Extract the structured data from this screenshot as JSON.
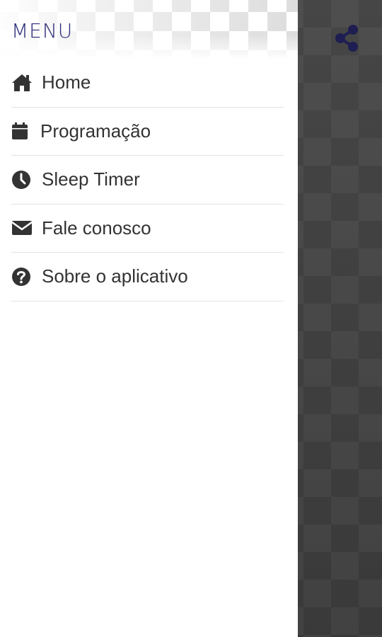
{
  "drawer": {
    "title": "MENU",
    "items": [
      {
        "label": "Home",
        "icon": "home-icon"
      },
      {
        "label": "Programação",
        "icon": "calendar-icon"
      },
      {
        "label": "Sleep Timer",
        "icon": "clock-icon"
      },
      {
        "label": "Fale conosco",
        "icon": "envelope-icon"
      },
      {
        "label": "Sobre o aplicativo",
        "icon": "question-circle-icon"
      }
    ]
  },
  "background": {
    "share_icon": "share-icon"
  },
  "colors": {
    "title": "#2a2a7a",
    "share_icon": "#1e1e52",
    "menu_text": "#333333",
    "background_dark": "#4a4a4a"
  }
}
